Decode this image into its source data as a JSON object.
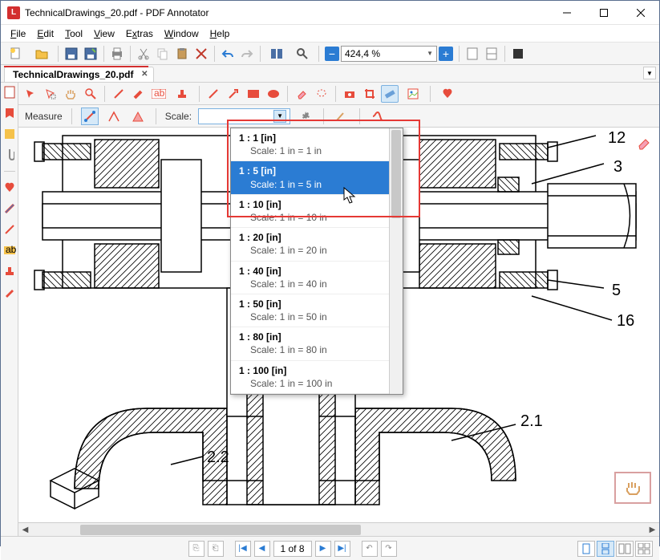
{
  "window": {
    "title": "TechnicalDrawings_20.pdf - PDF Annotator",
    "app_icon_letter": "L"
  },
  "menu": {
    "file": "File",
    "edit": "Edit",
    "tool": "Tool",
    "view": "View",
    "extras": "Extras",
    "window": "Window",
    "help": "Help"
  },
  "zoom": {
    "value": "424,4 %"
  },
  "tab": {
    "label": "TechnicalDrawings_20.pdf"
  },
  "measure": {
    "label": "Measure",
    "scale_label": "Scale:"
  },
  "scale_options": [
    {
      "title": "1 : 1 [in]",
      "sub": "Scale: 1 in = 1 in"
    },
    {
      "title": "1 : 5 [in]",
      "sub": "Scale: 1 in = 5 in"
    },
    {
      "title": "1 : 10 [in]",
      "sub": "Scale: 1 in = 10 in"
    },
    {
      "title": "1 : 20 [in]",
      "sub": "Scale: 1 in = 20 in"
    },
    {
      "title": "1 : 40 [in]",
      "sub": "Scale: 1 in = 40 in"
    },
    {
      "title": "1 : 50 [in]",
      "sub": "Scale: 1 in = 50 in"
    },
    {
      "title": "1 : 80 [in]",
      "sub": "Scale: 1 in = 80 in"
    },
    {
      "title": "1 : 100 [in]",
      "sub": "Scale: 1 in = 100 in"
    }
  ],
  "callouts": {
    "n12": "12",
    "n3": "3",
    "n5": "5",
    "n16": "16",
    "n21": "2.1",
    "n22": "2.2"
  },
  "status": {
    "page": "1 of 8"
  },
  "colors": {
    "accent": "#2b7cd3",
    "highlight": "#e53935",
    "red": "#d32f2f"
  }
}
